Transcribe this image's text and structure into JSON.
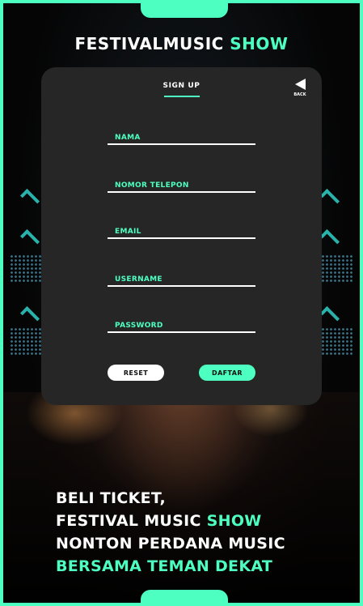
{
  "brand": {
    "title_main": "FESTIVALMUSIC",
    "title_accent": "SHOW"
  },
  "card": {
    "title": "SIGN UP",
    "back_label": "BACK",
    "fields": {
      "nama": {
        "placeholder": "NAMA",
        "value": ""
      },
      "telepon": {
        "placeholder": "NOMOR TELEPON",
        "value": ""
      },
      "email": {
        "placeholder": "EMAIL",
        "value": ""
      },
      "username": {
        "placeholder": "USERNAME",
        "value": ""
      },
      "password": {
        "placeholder": "PASSWORD",
        "value": ""
      }
    },
    "buttons": {
      "reset": "RESET",
      "daftar": "DAFTAR"
    }
  },
  "slogan": {
    "line1": "BELI TICKET,",
    "line2_main": "FESTIVAL MUSIC",
    "line2_accent": "SHOW",
    "line3": "NONTON PERDANA MUSIC",
    "line4_accent": "BERSAMA TEMAN DEKAT"
  },
  "colors": {
    "accent": "#4dffc0",
    "card": "#262626",
    "background": "#050505"
  }
}
